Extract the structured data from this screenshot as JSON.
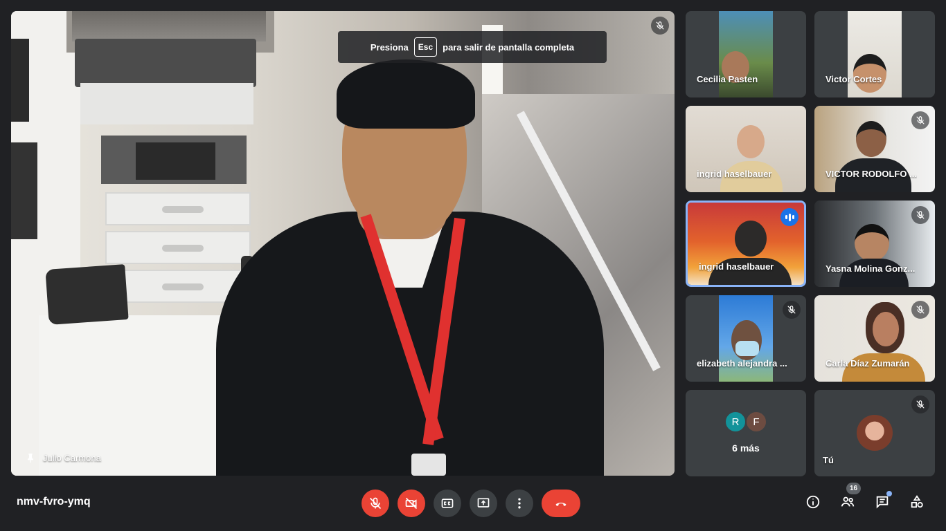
{
  "fullscreen_hint": {
    "before": "Presiona",
    "key": "Esc",
    "after": "para salir de pantalla completa"
  },
  "main_speaker": {
    "name": "Julio Carmona"
  },
  "participants": [
    {
      "name": "Cecilia Pasten",
      "muted": false
    },
    {
      "name": "Victor Cortes",
      "muted": false
    },
    {
      "name": "ingrid haselbauer",
      "muted": false
    },
    {
      "name": "VICTOR RODOLFO ...",
      "muted": true
    },
    {
      "name": "ingrid haselbauer",
      "muted": false,
      "speaking": true
    },
    {
      "name": "Yasna Molina Gonz...",
      "muted": true
    },
    {
      "name": "elizabeth alejandra ...",
      "muted": true
    },
    {
      "name": "Carla Díaz Zumarán",
      "muted": true
    }
  ],
  "more_tile": {
    "avatars": [
      "R",
      "F"
    ],
    "label": "6 más"
  },
  "self_tile": {
    "name": "Tú",
    "muted": true
  },
  "meeting_code": "nmv-fvro-ymq",
  "people_count": "16",
  "colors": {
    "end_call": "#ea4335",
    "active_border": "#8ab4f8",
    "speaking": "#1a73e8",
    "avatar_r": "#12939a",
    "avatar_f": "#6d4c41"
  }
}
